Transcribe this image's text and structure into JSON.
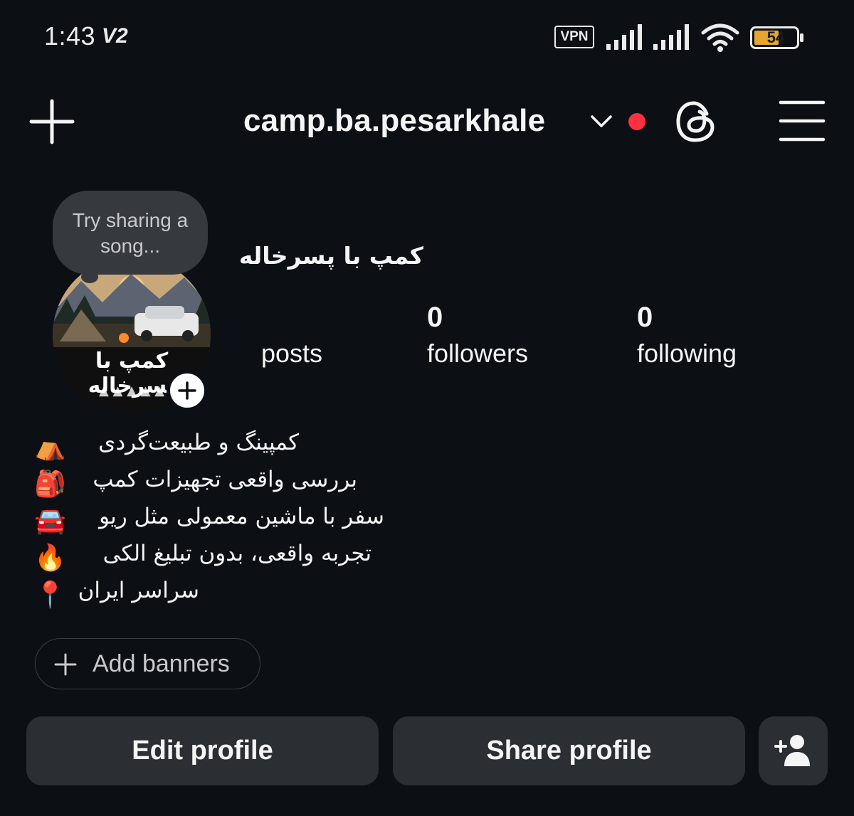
{
  "status_bar": {
    "time": "1:43",
    "carrier_label": "V2",
    "vpn_label": "VPN",
    "battery": "54",
    "battery_color": "#e6a430",
    "icons": [
      "signal-icon",
      "signal-icon",
      "wifi-icon",
      "battery-icon"
    ]
  },
  "header": {
    "username": "camp.ba.pesarkhale",
    "notification_dot_color": "#ff3040",
    "icons": [
      "plus-icon",
      "chevron-down-icon",
      "threads-icon",
      "menu-icon"
    ]
  },
  "profile": {
    "note": "Try sharing a song...",
    "avatar_text": "کمپ با پسرخاله",
    "display_name": "کمپ با پسرخاله",
    "stats": {
      "posts_label": "posts",
      "followers_count": "0",
      "followers_label": "followers",
      "following_count": "0",
      "following_label": "following"
    }
  },
  "bio": [
    {
      "text": "کمپینگ و طبیعت‌گردی",
      "emoji": "⛺"
    },
    {
      "text": "بررسی واقعی تجهیزات کمپ",
      "emoji": "🎒"
    },
    {
      "text": "سفر با ماشین معمولی مثل ریو",
      "emoji": "🚘"
    },
    {
      "text": "تجربه واقعی، بدون تبلیغ الکی",
      "emoji": "🔥"
    },
    {
      "text": "سراسر ایران",
      "emoji": "📍"
    }
  ],
  "banners": {
    "label": "Add banners"
  },
  "actions": {
    "edit_label": "Edit profile",
    "share_label": "Share profile"
  },
  "colors": {
    "background": "#0c1014",
    "button": "#2b2f33",
    "note_bubble": "#363a3f"
  }
}
